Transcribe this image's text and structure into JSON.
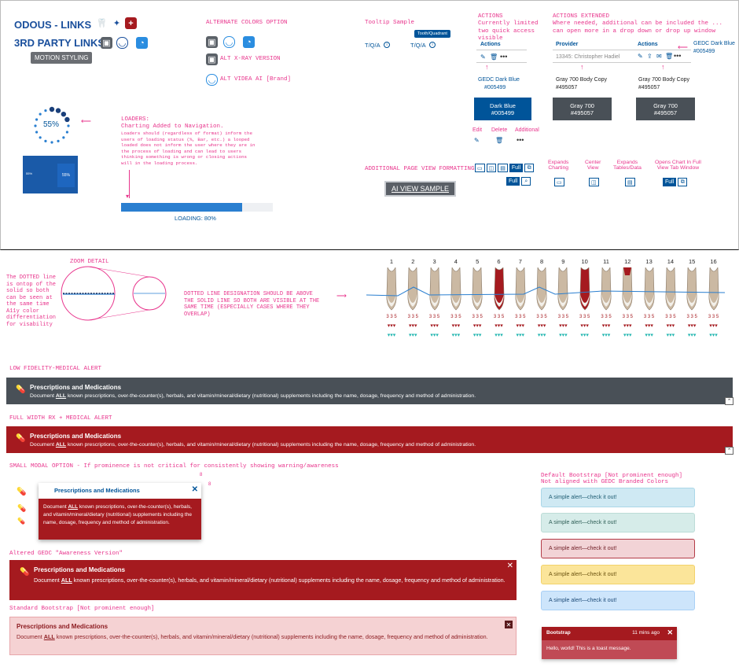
{
  "top": {
    "odous_links": "ODOUS - LINKS",
    "third_party_links": "3RD PARTY LINKS",
    "motion_styling": "MOTION STYLING",
    "alternate_colors": "ALTERNATE COLORS OPTION",
    "alt_xray": "ALT X-RAY VERSION",
    "alt_videa": "ALT VIDEA AI [Brand]",
    "tooltip_sample": "Tooltip Sample",
    "tooltip_text": "Tooth/Quadrant",
    "tqa1": "T/Q/A",
    "tqa2": "T/Q/A",
    "actions_title": "ACTIONS",
    "actions_note": "Currently limited\ntwo quick access\nvisible",
    "actions_ext_title": "ACTIONS EXTENDED",
    "actions_ext_note": "Where needed, additional can be included the ...\ncan open more in a drop down or drop up window",
    "actions_label": "Actions",
    "provider_label": "Provider",
    "actions_label2": "Actions",
    "provider_value": "13345: Christopher Hadiel",
    "gedc_dark_blue_note": "GEDC Dark Blue",
    "gedc_dark_blue_hex": "#005499",
    "gedc_label": "GEDC Dark Blue",
    "gedc_hex": "#005499",
    "gray_copy_label": "Gray 700 Body Copy",
    "gray_copy_hex": "#495057",
    "gray_copy_label2": "Gray 700 Body Copy",
    "gray_copy_hex2": "#495057",
    "swatch_dark_blue": "Dark Blue",
    "swatch_dark_blue_hex": "#005499",
    "swatch_gray": "Gray 700",
    "swatch_gray_hex": "#495057",
    "swatch_gray2": "Gray 700",
    "swatch_gray2_hex": "#495057",
    "edit": "Edit",
    "delete": "Delete",
    "additional": "Additional",
    "loaders_title": "LOADERS:",
    "loaders_sub": "Charting Added to Navigation.",
    "loaders_note": "Loaders should (regardless of format) inform the\nusers of loading status (%, Bar, etc.) a looped\nloaded does not inform the user where they are in\nthe process of loading and can lead to users\nthinking something is wrong or closing actions\nwill in the loading process.",
    "loader_percent": "55%",
    "mini_percent_a": "55%",
    "mini_percent_b": "55%",
    "loading_text": "LOADING: 80%",
    "loading_progress": 0.8,
    "additional_page_view": "ADDITIONAL PAGE VIEW FORMATTING",
    "full1": "Full",
    "full2": "Full",
    "full3": "Full",
    "ai_view_sample": "AI VIEW SAMPLE",
    "expands_charting": "Expands\nCharting",
    "center_view": "Center\nView",
    "expands_tables": "Expands\nTables/Data",
    "opens_chart": "Opens Chart In Full\nView Tab Window"
  },
  "zoom": {
    "zoom_detail": "ZOOM DETAIL",
    "dotted_note": "The DOTTED line\nis ontop of the\nsolid so both\ncan be seen at\nthe same time\nA11y color\ndifferentiation\nfor visability",
    "dotted_line_note": "DOTTED LINE DESIGNATION SHOULD BE ABOVE\nTHE SOLID LINE SO BOTH ARE VISIBLE AT THE\nSAME TIME (ESPECIALLY CASES WHERE THEY\nOVERLAP)"
  },
  "teeth": {
    "numbers": [
      "1",
      "2",
      "3",
      "4",
      "5",
      "6",
      "7",
      "8",
      "9",
      "10",
      "11",
      "12",
      "13",
      "14",
      "15",
      "16"
    ],
    "digits": "3 3 5"
  },
  "alerts": {
    "low_fidelity_label": "LOW FIDELITY-MEDICAL ALERT",
    "full_width_label": "FULL WIDTH RX + MEDICAL ALERT",
    "small_modal_label": "SMALL MODAL OPTION - If prominence is not critical for consistently showing warning/awareness",
    "altered_label": "Altered GEDC \"Awareness Version\"",
    "standard_label": "Standard Bootstrap [Not prominent enough]",
    "title": "Prescriptions and Medications",
    "body_pre": "Document ",
    "body_all": "ALL",
    "body_post": " known prescriptions, over-the-counter(s), herbals, and vitamin/mineral/dietary (nutritional) supplements including the name, dosage, frequency and method of administration.",
    "spacing_8a": "8",
    "spacing_8b": "8"
  },
  "bootstrap": {
    "label": "Default Bootstrap [Not prominent enough]\nNot aligned with GEDC Branded Colors",
    "alert_text": "A simple alert—check it out!",
    "toast_title": "Bootstrap",
    "toast_time": "11 mins ago",
    "toast_body": "Hello, world! This is a toast message."
  },
  "colors": {
    "dark_blue": "#005499",
    "gray_700": "#495057",
    "alert_red": "#a51a1f",
    "pink": "#e8348c"
  }
}
